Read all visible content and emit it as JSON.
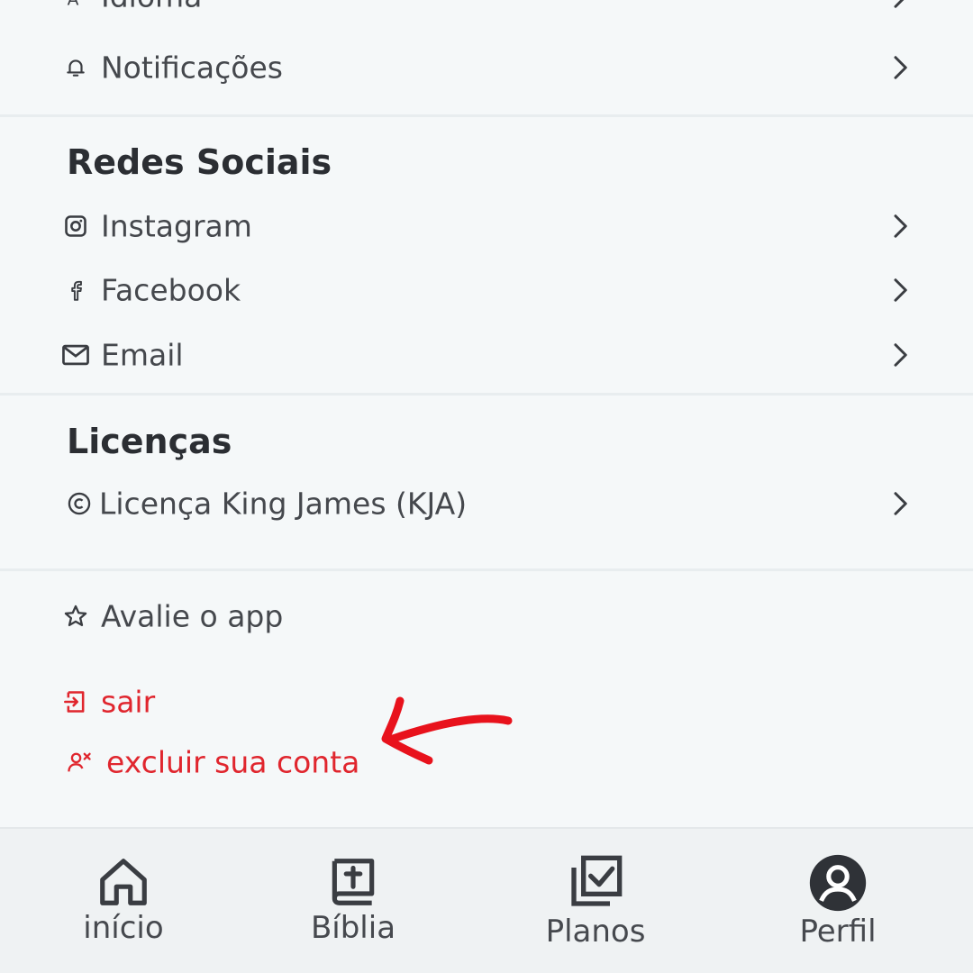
{
  "settings": {
    "idioma_label": "Idioma",
    "notificacoes_label": "Notificações"
  },
  "social": {
    "title": "Redes Sociais",
    "instagram_label": "Instagram",
    "facebook_label": "Facebook",
    "email_label": "Email"
  },
  "licenses": {
    "title": "Licenças",
    "kja_label": "Licença King James (KJA)"
  },
  "actions": {
    "rate_label": "Avalie o app",
    "logout_label": "sair",
    "delete_label": "excluir sua conta"
  },
  "colors": {
    "danger": "#e0262e",
    "text": "#45484d",
    "background": "#f5f8f9"
  },
  "tabbar": {
    "home_label": "início",
    "bible_label": "Bíblia",
    "plans_label": "Planos",
    "profile_label": "Perfil",
    "active": "Perfil"
  }
}
